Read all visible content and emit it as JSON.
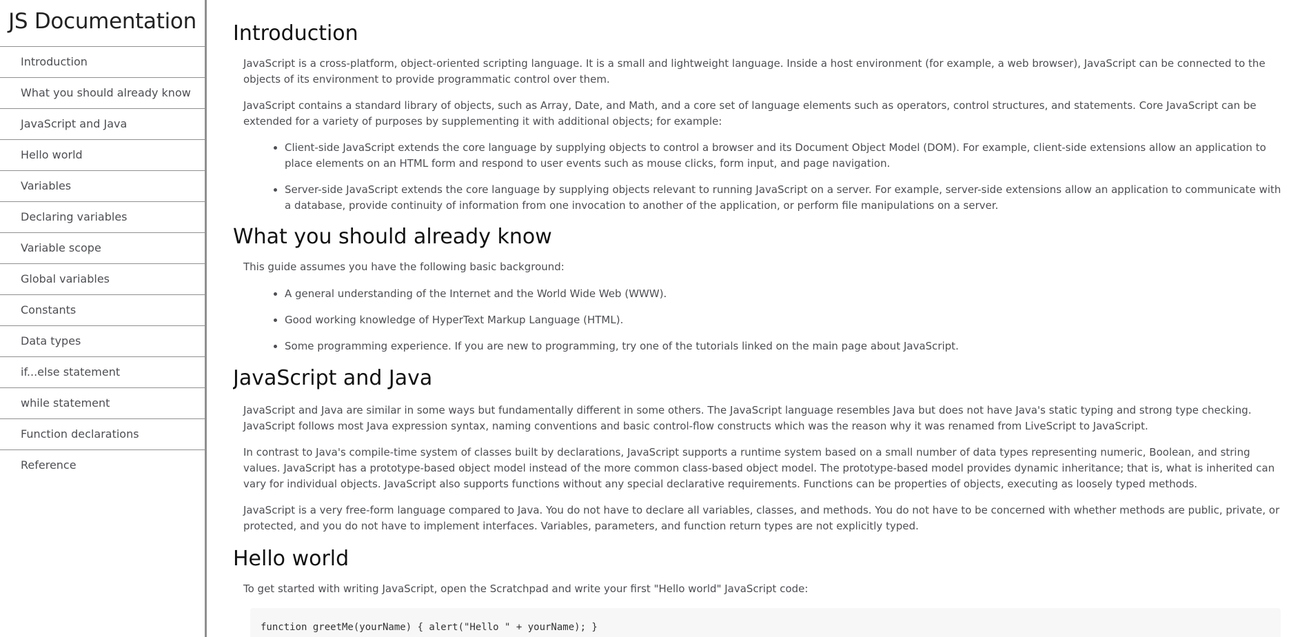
{
  "navbar": {
    "title": "JS Documentation",
    "items": [
      {
        "label": "Introduction"
      },
      {
        "label": "What you should already know"
      },
      {
        "label": "JavaScript and Java"
      },
      {
        "label": "Hello world"
      },
      {
        "label": "Variables"
      },
      {
        "label": "Declaring variables"
      },
      {
        "label": "Variable scope"
      },
      {
        "label": "Global variables"
      },
      {
        "label": "Constants"
      },
      {
        "label": "Data types"
      },
      {
        "label": "if...else statement"
      },
      {
        "label": "while statement"
      },
      {
        "label": "Function declarations"
      },
      {
        "label": "Reference"
      }
    ]
  },
  "main": {
    "introduction": {
      "heading": "Introduction",
      "p1": "JavaScript is a cross-platform, object-oriented scripting language. It is a small and lightweight language. Inside a host environment (for example, a web browser), JavaScript can be connected to the objects of its environment to provide programmatic control over them.",
      "p2": "JavaScript contains a standard library of objects, such as Array, Date, and Math, and a core set of language elements such as operators, control structures, and statements. Core JavaScript can be extended for a variety of purposes by supplementing it with additional objects; for example:",
      "list": [
        "Client-side JavaScript extends the core language by supplying objects to control a browser and its Document Object Model (DOM). For example, client-side extensions allow an application to place elements on an HTML form and respond to user events such as mouse clicks, form input, and page navigation.",
        "Server-side JavaScript extends the core language by supplying objects relevant to running JavaScript on a server. For example, server-side extensions allow an application to communicate with a database, provide continuity of information from one invocation to another of the application, or perform file manipulations on a server."
      ]
    },
    "what_you_should_know": {
      "heading": "What you should already know",
      "p1": "This guide assumes you have the following basic background:",
      "list": [
        "A general understanding of the Internet and the World Wide Web (WWW).",
        "Good working knowledge of HyperText Markup Language (HTML).",
        "Some programming experience. If you are new to programming, try one of the tutorials linked on the main page about JavaScript."
      ]
    },
    "javascript_and_java": {
      "heading": "JavaScript and Java",
      "p1": "JavaScript and Java are similar in some ways but fundamentally different in some others. The JavaScript language resembles Java but does not have Java's static typing and strong type checking. JavaScript follows most Java expression syntax, naming conventions and basic control-flow constructs which was the reason why it was renamed from LiveScript to JavaScript.",
      "p2": "In contrast to Java's compile-time system of classes built by declarations, JavaScript supports a runtime system based on a small number of data types representing numeric, Boolean, and string values. JavaScript has a prototype-based object model instead of the more common class-based object model. The prototype-based model provides dynamic inheritance; that is, what is inherited can vary for individual objects. JavaScript also supports functions without any special declarative requirements. Functions can be properties of objects, executing as loosely typed methods.",
      "p3": "JavaScript is a very free-form language compared to Java. You do not have to declare all variables, classes, and methods. You do not have to be concerned with whether methods are public, private, or protected, and you do not have to implement interfaces. Variables, parameters, and function return types are not explicitly typed."
    },
    "hello_world": {
      "heading": "Hello world",
      "p1": "To get started with writing JavaScript, open the Scratchpad and write your first \"Hello world\" JavaScript code:",
      "code": "function greetMe(yourName) { alert(\"Hello \" + yourName); }"
    }
  }
}
